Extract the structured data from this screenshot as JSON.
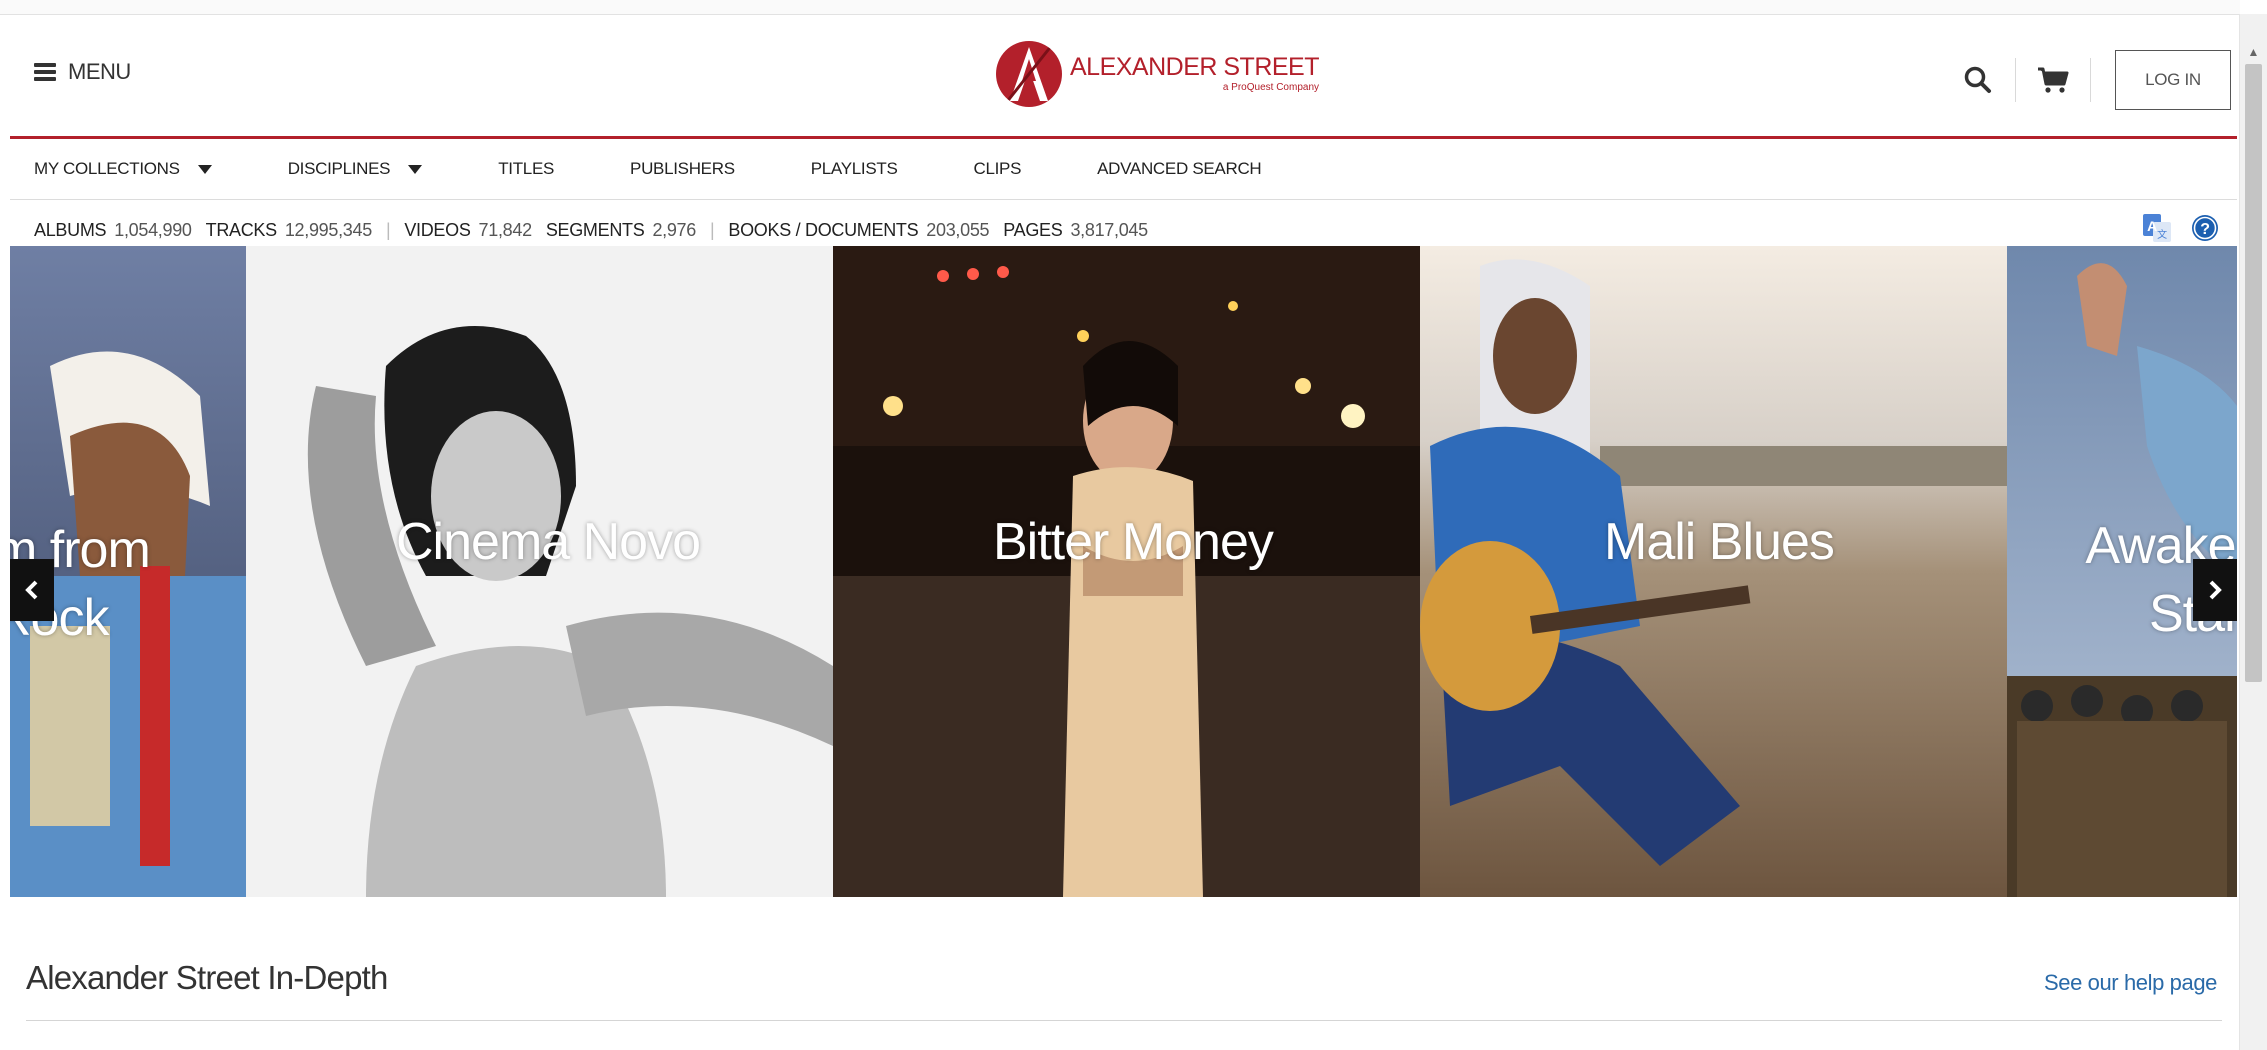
{
  "header": {
    "menu_label": "MENU",
    "logo_name": "ALEXANDER STREET",
    "logo_sub": "a ProQuest Company",
    "login_label": "LOG IN"
  },
  "nav": {
    "items": [
      {
        "label": "MY COLLECTIONS",
        "dropdown": true
      },
      {
        "label": "DISCIPLINES",
        "dropdown": true
      },
      {
        "label": "TITLES"
      },
      {
        "label": "PUBLISHERS"
      },
      {
        "label": "PLAYLISTS"
      },
      {
        "label": "CLIPS"
      },
      {
        "label": "ADVANCED SEARCH"
      }
    ]
  },
  "stats": {
    "albums_label": "ALBUMS",
    "albums_value": "1,054,990",
    "tracks_label": "TRACKS",
    "tracks_value": "12,995,345",
    "videos_label": "VIDEOS",
    "videos_value": "71,842",
    "segments_label": "SEGMENTS",
    "segments_value": "2,976",
    "books_label": "BOOKS / DOCUMENTS",
    "books_value": "203,055",
    "pages_label": "PAGES",
    "pages_value": "3,817,045"
  },
  "carousel": {
    "slides": [
      {
        "title_line1": "m from",
        "title_line2": "Rock"
      },
      {
        "title": "Cinema Novo"
      },
      {
        "title": "Bitter Money"
      },
      {
        "title": "Mali Blues"
      },
      {
        "title_line1": "Awake",
        "title_line2": "Stan"
      }
    ]
  },
  "section": {
    "title": "Alexander Street In-Depth",
    "help_link": "See our help page"
  },
  "colors": {
    "brand_red": "#b3202b",
    "link_blue": "#2a6aa8",
    "help_icon_blue": "#1c5fb0"
  },
  "icons": [
    "hamburger-icon",
    "search-icon",
    "cart-icon",
    "translate-icon",
    "help-icon",
    "chevron-left-icon",
    "chevron-right-icon",
    "caret-down-icon"
  ]
}
